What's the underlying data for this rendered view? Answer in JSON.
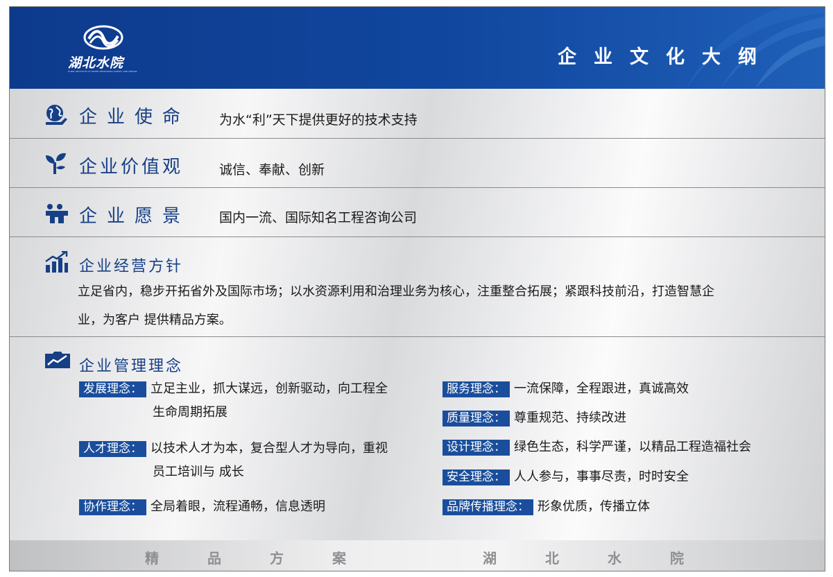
{
  "header": {
    "logo_text": "湖北水院",
    "logo_sub": "HUBEI INSTITUTE OF WATER RESOURCES SURVEY AND DESIGN",
    "title": "企业文化大纲"
  },
  "mission": {
    "heading": "企业使命",
    "text": "为水“利”天下提供更好的技术支持"
  },
  "values": {
    "heading": "企业价值观",
    "text": "诚信、奉献、创新"
  },
  "vision": {
    "heading": "企业愿景",
    "text": "国内一流、国际知名工程咨询公司"
  },
  "policy": {
    "heading": "企业经营方针",
    "line1": "立足省内，稳步开拓省外及国际市场；以水资源利用和治理业务为核心，注重整合拓展；紧跟科技前沿，打造智慧企",
    "line2": "业，为客户 提供精品方案。"
  },
  "management": {
    "heading": "企业管理理念",
    "left": [
      {
        "tag": "发展理念：",
        "line1": "立足主业，抓大谋远，创新驱动，向工程全",
        "line2": "生命周期拓展"
      },
      {
        "tag": "人才理念：",
        "line1": "以技术人才为本，复合型人才为导向，重视",
        "line2": "员工培训与 成长"
      },
      {
        "tag": "协作理念：",
        "line1": "全局着眼，流程通畅，信息透明",
        "line2": ""
      }
    ],
    "right": [
      {
        "tag": "服务理念：",
        "text": "一流保障，全程跟进，真诚高效"
      },
      {
        "tag": "质量理念：",
        "text": "尊重规范、持续改进"
      },
      {
        "tag": "设计理念：",
        "text": "绿色生态，科学严谨，以精品工程造福社会"
      },
      {
        "tag": "安全理念：",
        "text": "人人参与，事事尽责，时时安全"
      },
      {
        "tag": "品牌传播理念：",
        "text": "形象优质，传播立体"
      }
    ]
  },
  "footer": {
    "left": [
      "精",
      "品",
      "方",
      "案"
    ],
    "right": [
      "湖",
      "北",
      "水",
      "院"
    ]
  },
  "colors": {
    "brand_blue": "#11479f",
    "tag_blue": "#1a4e9c",
    "heading_blue": "#163f86"
  }
}
